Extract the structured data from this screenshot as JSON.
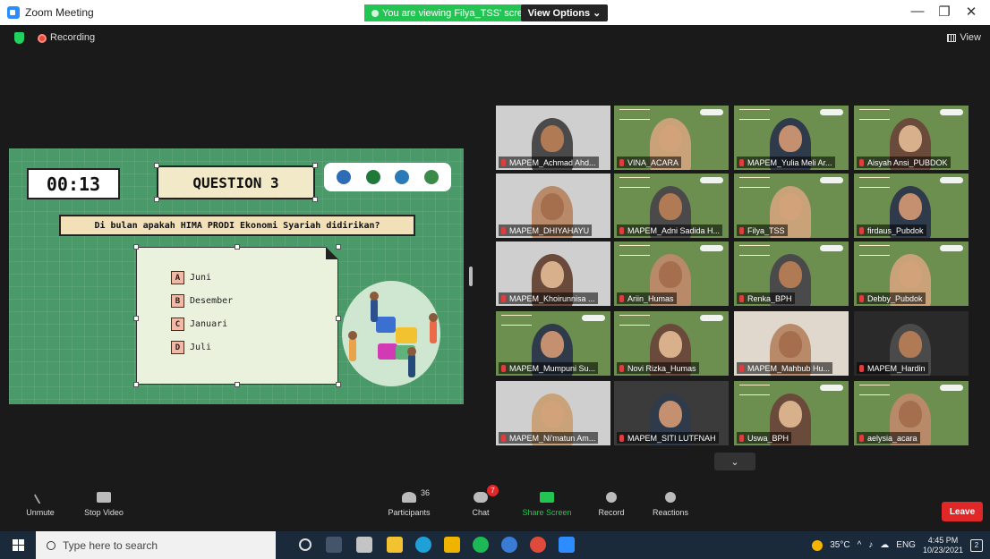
{
  "window": {
    "title": "Zoom Meeting",
    "viewing_banner": "You are viewing Filya_TSS' screen",
    "view_options": "View Options ⌄",
    "minimize": "—",
    "restore": "❐",
    "close": "✕"
  },
  "meeting": {
    "recording_label": "Recording",
    "view_label": "View"
  },
  "slide": {
    "timer": "00:13",
    "question_title": "QUESTION 3",
    "question_text": "Di bulan apakah HIMA PRODI Ekonomi Syariah didirikan?",
    "options": [
      {
        "letter": "A",
        "text": "Juni"
      },
      {
        "letter": "B",
        "text": "Desember"
      },
      {
        "letter": "C",
        "text": "Januari"
      },
      {
        "letter": "D",
        "text": "Juli"
      }
    ]
  },
  "gallery": {
    "participants": [
      "MAPEM_Achmad Ahd...",
      "VINA_ACARA",
      "MAPEM_Yulia Meli Ar...",
      "Aisyah Ansi_PUBDOK",
      "MAPEM_DHIYAHAYU",
      "MAPEM_Adni Sadida H...",
      "Filya_TSS",
      "firdaus_Pubdok",
      "MAPEM_Khoirunnisa ...",
      "Ariin_Humas",
      "Renka_BPH",
      "Debby_Pubdok",
      "MAPEM_Mumpuni Su...",
      "Novi Rizka_Humas",
      "MAPEM_Mahbub Hu...",
      "MAPEM_Hardin",
      "MAPEM_Ni'matun Am...",
      "MAPEM_SITI LUTFNAH",
      "Uswa_BPH",
      "aelysia_acara"
    ]
  },
  "toolbar": {
    "unmute": "Unmute",
    "stop_video": "Stop Video",
    "participants": "Participants",
    "participants_count": "36",
    "chat": "Chat",
    "chat_badge": "7",
    "share_screen": "Share Screen",
    "record": "Record",
    "reactions": "Reactions",
    "leave": "Leave"
  },
  "taskbar": {
    "search_placeholder": "Type here to search",
    "temperature": "35°C",
    "language": "ENG",
    "time": "4:45 PM",
    "date": "10/23/2021",
    "notifications_count": "2"
  }
}
